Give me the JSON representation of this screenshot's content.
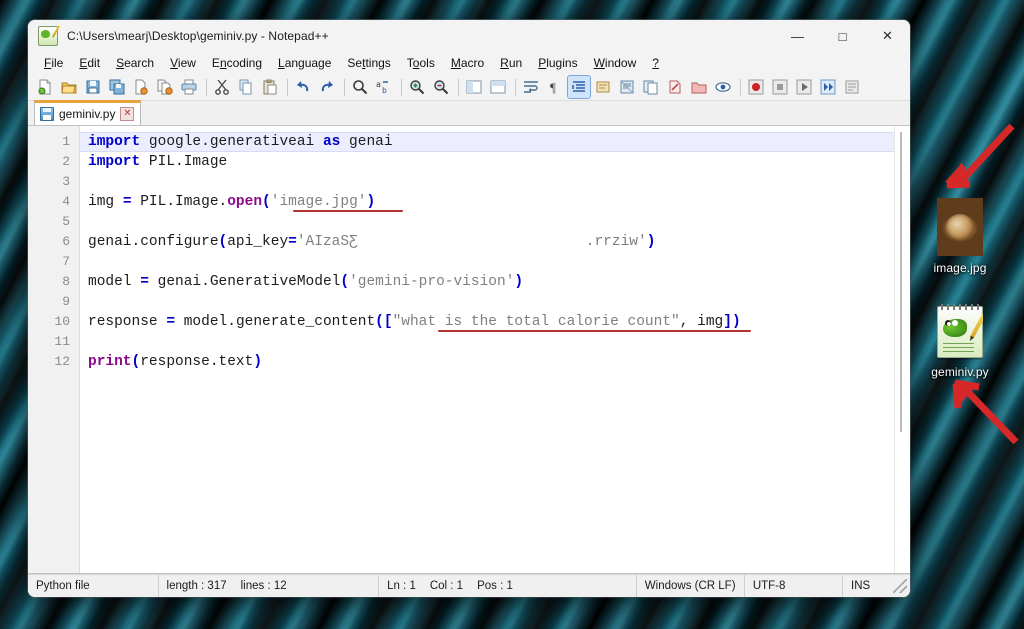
{
  "window": {
    "title": "C:\\Users\\mearj\\Desktop\\geminiv.py - Notepad++",
    "app_icon": "notepad-plus-plus-icon",
    "controls": {
      "minimize": "—",
      "maximize": "□",
      "close": "✕"
    }
  },
  "menubar": {
    "items": [
      {
        "label": "File",
        "accel": "F"
      },
      {
        "label": "Edit",
        "accel": "E"
      },
      {
        "label": "Search",
        "accel": "S"
      },
      {
        "label": "View",
        "accel": "V"
      },
      {
        "label": "Encoding",
        "accel": "n"
      },
      {
        "label": "Language",
        "accel": "L"
      },
      {
        "label": "Settings",
        "accel": "t"
      },
      {
        "label": "Tools",
        "accel": "o"
      },
      {
        "label": "Macro",
        "accel": "M"
      },
      {
        "label": "Run",
        "accel": "R"
      },
      {
        "label": "Plugins",
        "accel": "P"
      },
      {
        "label": "Window",
        "accel": "W"
      },
      {
        "label": "?",
        "accel": "?"
      }
    ]
  },
  "toolbar": {
    "buttons": [
      {
        "name": "new-file-icon",
        "glyph": "🗎"
      },
      {
        "name": "open-file-icon",
        "glyph": "📂"
      },
      {
        "name": "save-icon",
        "glyph": "💾"
      },
      {
        "name": "save-all-icon",
        "glyph": "🗂"
      },
      {
        "name": "close-file-icon",
        "glyph": "🗋"
      },
      {
        "name": "close-all-icon",
        "glyph": "🗃"
      },
      {
        "name": "print-icon",
        "glyph": "🖨"
      },
      {
        "name": "separator-1",
        "glyph": "|"
      },
      {
        "name": "cut-icon",
        "glyph": "✂"
      },
      {
        "name": "copy-icon",
        "glyph": "⧉"
      },
      {
        "name": "paste-icon",
        "glyph": "📋"
      },
      {
        "name": "separator-2",
        "glyph": "|"
      },
      {
        "name": "undo-icon",
        "glyph": "↶"
      },
      {
        "name": "redo-icon",
        "glyph": "↷"
      },
      {
        "name": "separator-3",
        "glyph": "|"
      },
      {
        "name": "find-icon",
        "glyph": "🔍"
      },
      {
        "name": "replace-icon",
        "glyph": "⫤"
      },
      {
        "name": "separator-4",
        "glyph": "|"
      },
      {
        "name": "zoom-in-icon",
        "glyph": "⊕"
      },
      {
        "name": "zoom-out-icon",
        "glyph": "⊖"
      },
      {
        "name": "separator-5",
        "glyph": "|"
      },
      {
        "name": "sync-vertical-icon",
        "glyph": "◫"
      },
      {
        "name": "sync-horizontal-icon",
        "glyph": "▤"
      },
      {
        "name": "separator-6",
        "glyph": "|"
      },
      {
        "name": "word-wrap-icon",
        "glyph": "↩"
      },
      {
        "name": "show-all-chars-icon",
        "glyph": "¶"
      },
      {
        "name": "indent-guide-icon",
        "glyph": "≡"
      },
      {
        "name": "user-lang-icon",
        "glyph": "▣"
      },
      {
        "name": "doc-map-icon",
        "glyph": "▨"
      },
      {
        "name": "function-list-icon",
        "glyph": "☰"
      },
      {
        "name": "doc-switcher-icon",
        "glyph": "✎"
      },
      {
        "name": "folder-workspace-icon",
        "glyph": "🗁"
      },
      {
        "name": "monitoring-icon",
        "glyph": "👁"
      },
      {
        "name": "separator-7",
        "glyph": "|"
      },
      {
        "name": "macro-record-icon",
        "glyph": "●"
      },
      {
        "name": "macro-stop-icon",
        "glyph": "■"
      },
      {
        "name": "macro-play-icon",
        "glyph": "▶"
      },
      {
        "name": "macro-playmany-icon",
        "glyph": "⏩"
      },
      {
        "name": "macro-save-icon",
        "glyph": "⊞"
      }
    ]
  },
  "tabbar": {
    "tabs": [
      {
        "label": "geminiv.py",
        "close_glyph": "✕",
        "active": true
      }
    ],
    "right_controls": [
      {
        "name": "new-tab-button",
        "glyph": "+"
      },
      {
        "name": "tab-list-button",
        "glyph": "▼"
      },
      {
        "name": "close-tab-button",
        "glyph": "✕"
      }
    ]
  },
  "editor": {
    "line_numbers": [
      "1",
      "2",
      "3",
      "4",
      "5",
      "6",
      "7",
      "8",
      "9",
      "10",
      "11",
      "12"
    ],
    "lines": [
      {
        "n": 1,
        "text": "import google.generativeai as genai"
      },
      {
        "n": 2,
        "text": "import PIL.Image"
      },
      {
        "n": 3,
        "text": ""
      },
      {
        "n": 4,
        "text": "img = PIL.Image.open('image.jpg')"
      },
      {
        "n": 5,
        "text": ""
      },
      {
        "n": 6,
        "text": "genai.configure(api_key='AIzaS…rrziw')"
      },
      {
        "n": 7,
        "text": ""
      },
      {
        "n": 8,
        "text": "model = genai.GenerativeModel('gemini-pro-vision')"
      },
      {
        "n": 9,
        "text": ""
      },
      {
        "n": 10,
        "text": "response = model.generate_content([\"what is the total calorie count\", img])"
      },
      {
        "n": 11,
        "text": ""
      },
      {
        "n": 12,
        "text": "print(response.text)"
      }
    ],
    "tokens": {
      "kw_import": "import",
      "kw_as": "as",
      "mod_google": " google.generativeai ",
      "mod_genai": " genai",
      "mod_pil": " PIL.Image",
      "img_var": "img ",
      "eq": "=",
      "pil_open": " PIL.Image.",
      "open_kw": "open",
      "lparen": "(",
      "rparen": ")",
      "str_image": "'image.jpg'",
      "genai_configure": "genai.configure",
      "api_key_arg": "api_key",
      "str_key_head": "'AIzaSƸ",
      "str_key_tail": ".rrziw'",
      "model_var": "model ",
      "genai_model": " genai.GenerativeModel",
      "str_model": "'gemini-pro-vision'",
      "response_var": "response ",
      "model_generate": " model.generate_content",
      "lbracket": "([",
      "str_prompt": "\"what is the total calorie count\"",
      "comma_img": ", img",
      "rbracket": "])",
      "print_kw": "print",
      "response_text": "response.text"
    },
    "colors": {
      "keyword": "#0000c8",
      "builtin": "#8b0a8b",
      "string": "#808080",
      "operator": "#0000c8",
      "plain": "#1c1c1c",
      "current_line_bg": "#eceeff",
      "gutter_bg": "#f1f1f1",
      "gutter_fg": "#8b8b8b",
      "annotation_red": "#b5332f"
    }
  },
  "statusbar": {
    "file_type": "Python file",
    "length_label": "length : 317",
    "lines_label": "lines : 12",
    "ln": "Ln : 1",
    "col": "Col : 1",
    "pos": "Pos : 1",
    "eol": "Windows (CR LF)",
    "encoding": "UTF-8",
    "insert_mode": "INS"
  },
  "desktop": {
    "icons": [
      {
        "name": "desktop-icon-image-jpg",
        "label": "image.jpg",
        "type": "photo"
      },
      {
        "name": "desktop-icon-geminiv-py",
        "label": "geminiv.py",
        "type": "notepadpp"
      }
    ],
    "annotations": [
      {
        "name": "red-arrow-to-image",
        "direction": "down-left",
        "color": "#d62828"
      },
      {
        "name": "red-arrow-to-script",
        "direction": "up-left",
        "color": "#d62828"
      }
    ],
    "wallpaper_colors": {
      "base": "#07171c",
      "accent": "#2a9ab5",
      "dark": "#020b0e"
    }
  }
}
